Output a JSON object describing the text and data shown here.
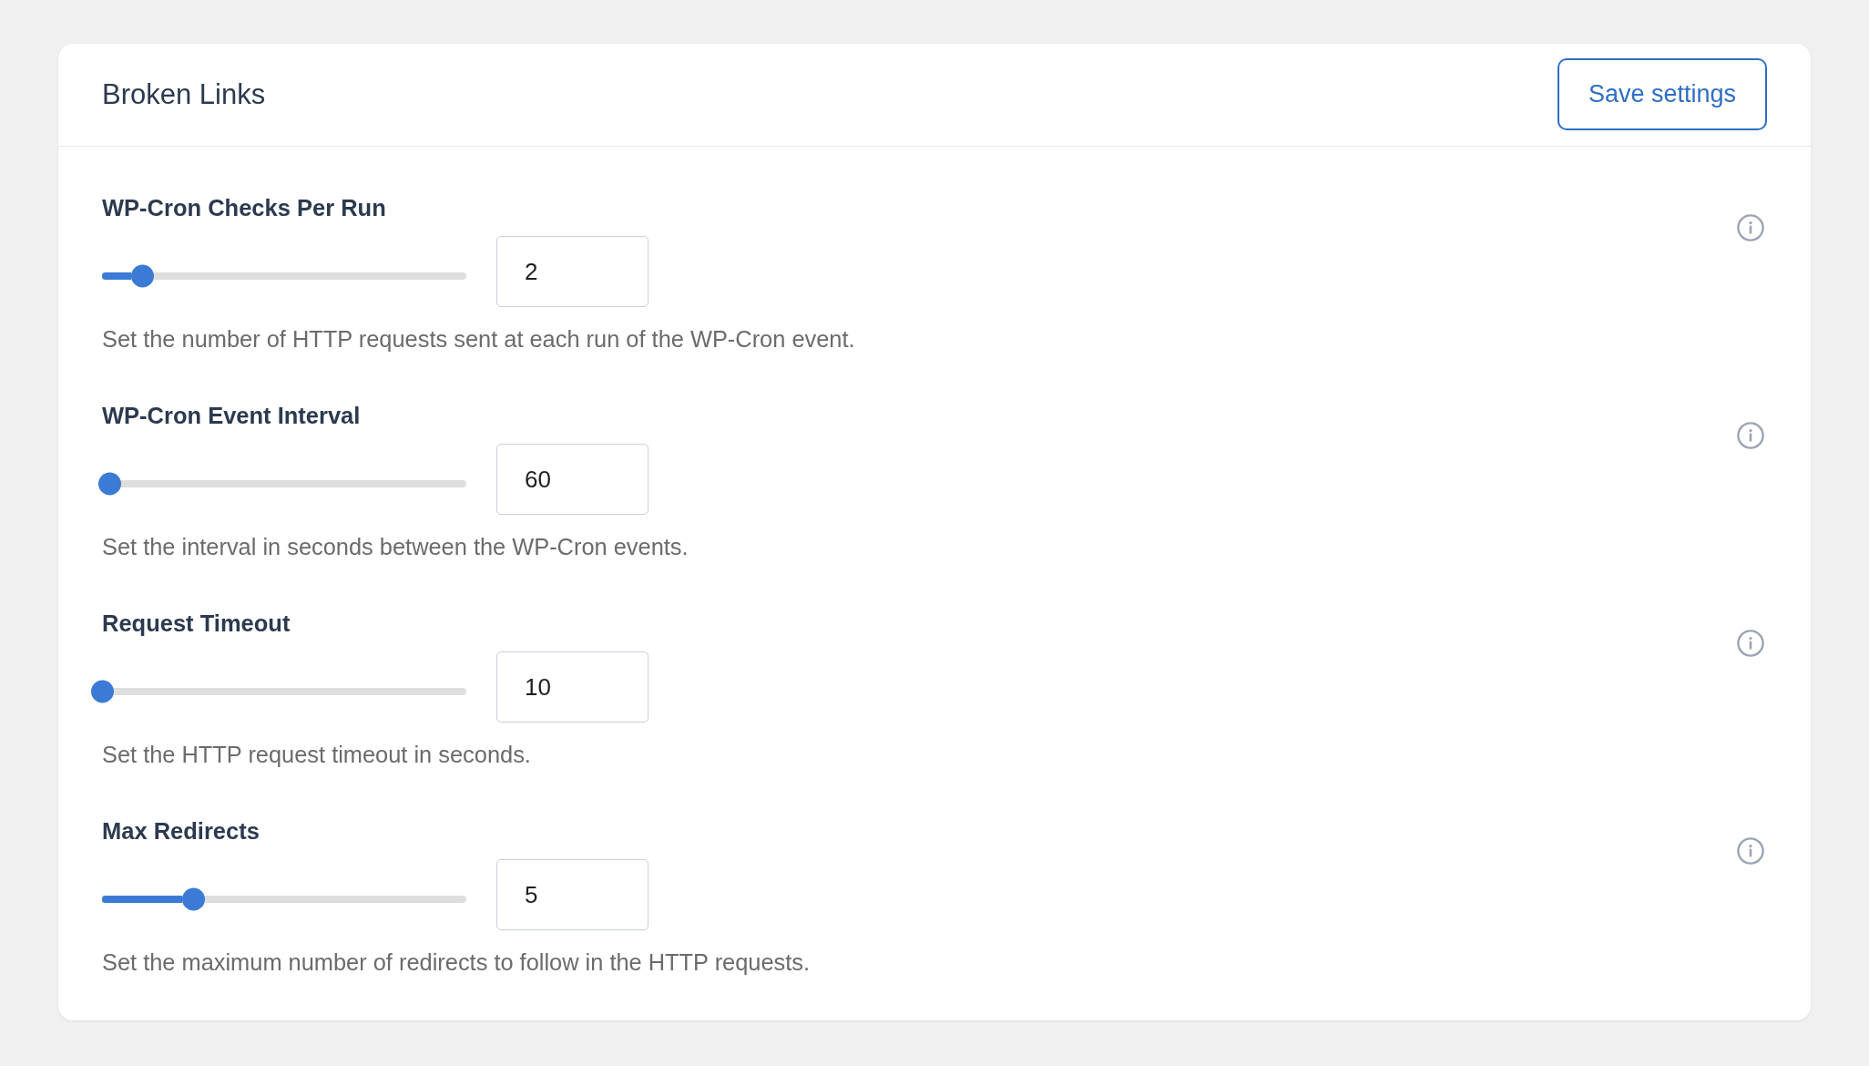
{
  "header": {
    "title": "Broken Links",
    "save_button": "Save settings"
  },
  "settings": [
    {
      "label": "WP-Cron Checks Per Run",
      "level": 0.11,
      "value": "2",
      "description": "Set the number of HTTP requests sent at each run of the WP-Cron event."
    },
    {
      "label": "WP-Cron Event Interval",
      "level": 0.02,
      "value": "60",
      "description": "Set the interval in seconds between the WP-Cron events."
    },
    {
      "label": "Request Timeout",
      "level": 0,
      "value": "10",
      "description": "Set the HTTP request timeout in seconds."
    },
    {
      "label": "Max Redirects",
      "level": 0.25,
      "value": "5",
      "description": "Set the maximum number of redirects to follow in the HTTP requests."
    }
  ]
}
